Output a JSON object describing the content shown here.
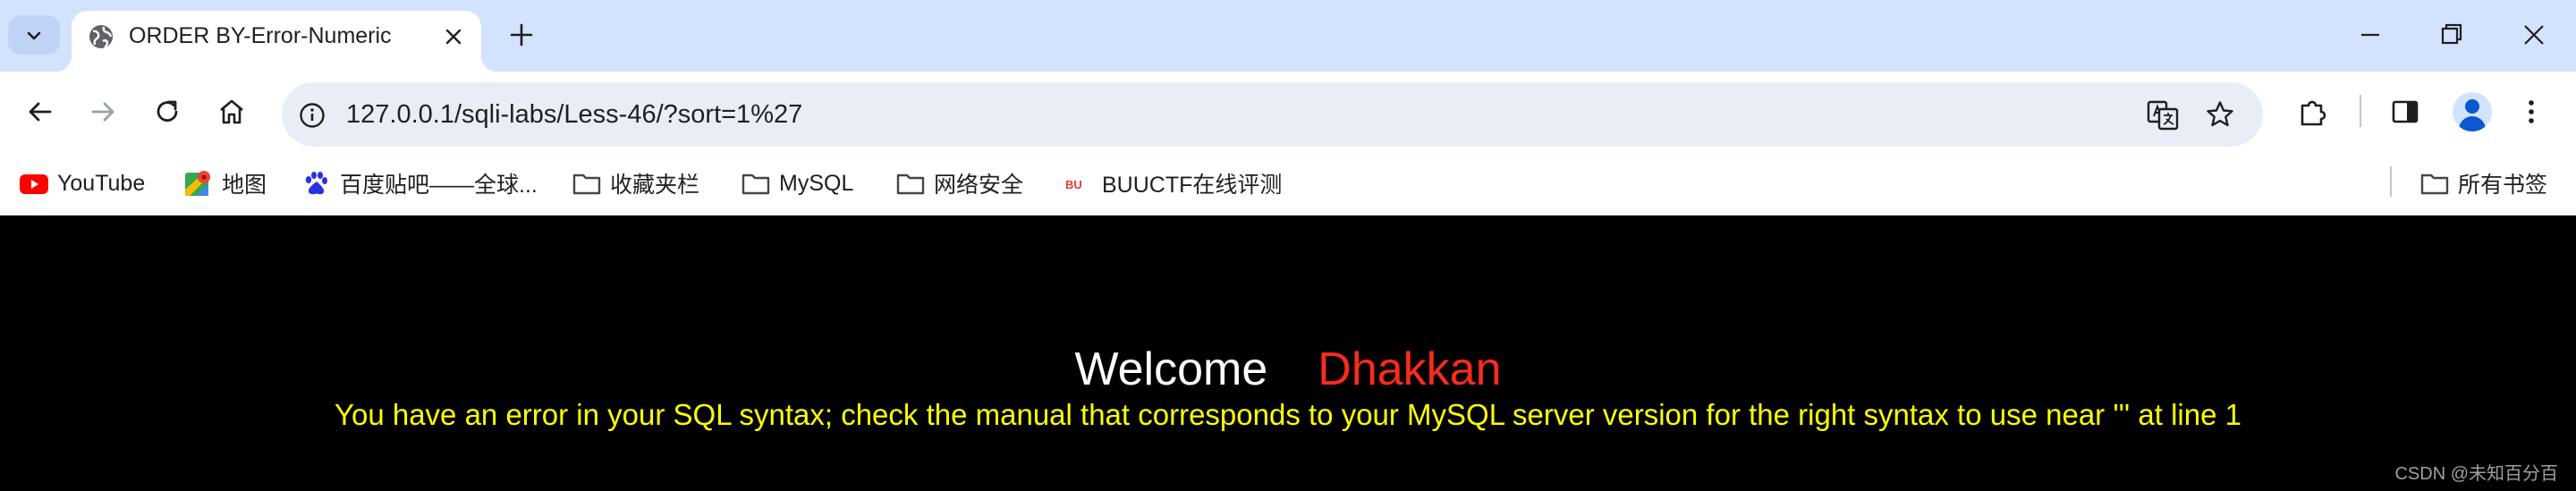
{
  "tab": {
    "title": "ORDER BY-Error-Numeric"
  },
  "toolbar": {
    "url": "127.0.0.1/sqli-labs/Less-46/?sort=1%27"
  },
  "bookmarks": {
    "items": [
      {
        "label": "YouTube",
        "icon": "youtube-icon"
      },
      {
        "label": "地图",
        "icon": "maps-icon"
      },
      {
        "label": "百度贴吧——全球...",
        "icon": "baidu-icon"
      },
      {
        "label": "收藏夹栏",
        "icon": "folder-icon"
      },
      {
        "label": "MySQL",
        "icon": "folder-icon"
      },
      {
        "label": "网络安全",
        "icon": "folder-icon"
      },
      {
        "label": "BUUCTF在线评测",
        "icon": "buuctf-icon"
      }
    ],
    "all_bookmarks": "所有书签"
  },
  "page": {
    "welcome": "Welcome",
    "username": "Dhakkan",
    "error": "You have an error in your SQL syntax; check the manual that corresponds to your MySQL server version for the right syntax to use near ''' at line 1",
    "watermark": "CSDN @未知百分百"
  },
  "colors": {
    "page_background": "#000000",
    "welcome_text": "#ffffff",
    "username_text": "#ff2a1a",
    "error_text": "#ffff00",
    "tabstrip": "#d3e3fd",
    "omnibox": "#e9eef6"
  }
}
